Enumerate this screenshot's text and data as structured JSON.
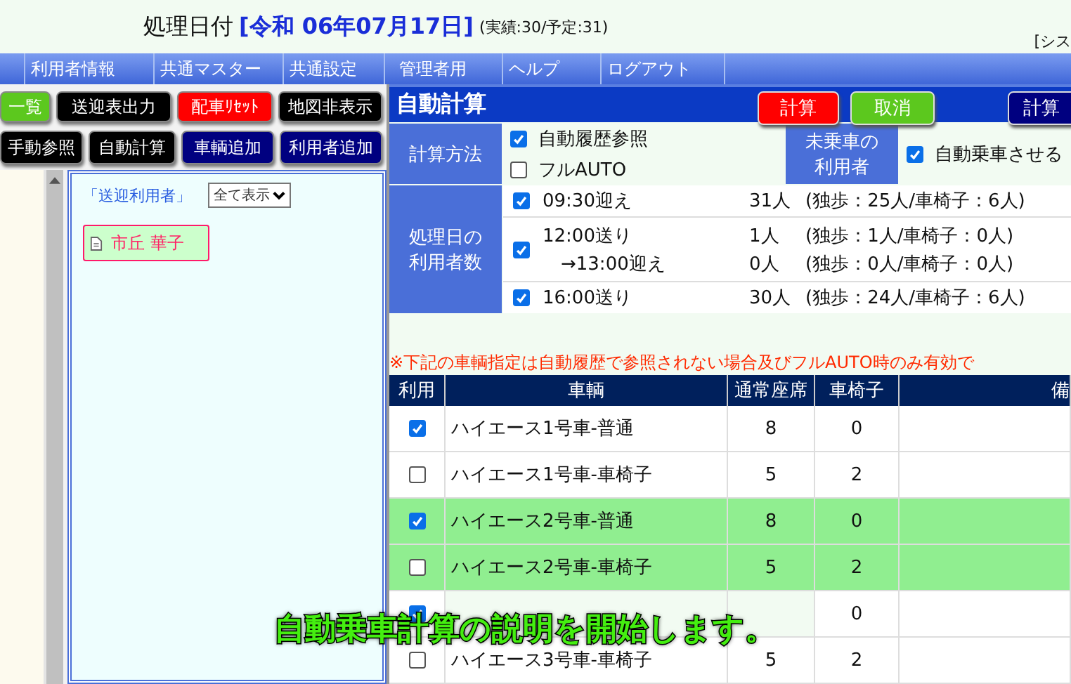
{
  "header": {
    "date_label": "処理日付",
    "date_value": "[令和 06年07月17日]",
    "counts": "(実績:30/予定:31)",
    "system_link": "[シス"
  },
  "menu": [
    "利用者情報",
    "共通マスター",
    "共通設定",
    "管理者用",
    "ヘルプ",
    "ログアウト"
  ],
  "left_buttons": [
    {
      "label": "一覧",
      "color": "#5cc81e"
    },
    {
      "label": "送迎表出力",
      "color": "#000000"
    },
    {
      "label": "配車ﾘｾｯﾄ",
      "color": "#ff0000"
    },
    {
      "label": "地図非表示",
      "color": "#000000"
    },
    {
      "label": "手動参照",
      "color": "#000000"
    },
    {
      "label": "自動計算",
      "color": "#000000"
    },
    {
      "label": "車輌追加",
      "color": "#000080"
    },
    {
      "label": "利用者追加",
      "color": "#000080"
    }
  ],
  "pickup_panel": {
    "title": "「送迎利用者」",
    "filter": "全て表示",
    "users": [
      "市丘 華子"
    ]
  },
  "auto_calc": {
    "title": "自動計算",
    "buttons": [
      {
        "label": "計算",
        "color": "#ff0000"
      },
      {
        "label": "取消",
        "color": "#5cc81e"
      },
      {
        "label": "計算",
        "color": "#000080"
      }
    ],
    "method_label": "計算方法",
    "methods": [
      {
        "label": "自動履歴参照",
        "checked": true
      },
      {
        "label": "フルAUTO",
        "checked": false
      }
    ],
    "unboarded_label": "未乗車の利用者",
    "unboarded_option": {
      "label": "自動乗車させる",
      "checked": true
    },
    "counts_label": "処理日の利用者数",
    "slots": [
      {
        "checked": true,
        "lines": [
          {
            "time": "09:30迎え",
            "count": "31人",
            "detail": "(独歩：25人/車椅子：6人)"
          }
        ]
      },
      {
        "checked": true,
        "lines": [
          {
            "time": "12:00送り",
            "count": "1人",
            "detail": "(独歩：1人/車椅子：0人)"
          },
          {
            "time": "→13:00迎え",
            "count": "0人",
            "detail": "(独歩：0人/車椅子：0人)"
          }
        ]
      },
      {
        "checked": true,
        "lines": [
          {
            "time": "16:00送り",
            "count": "30人",
            "detail": "(独歩：24人/車椅子：6人)"
          }
        ]
      }
    ],
    "notice": "※下記の車輌指定は自動履歴で参照されない場合及びフルAUTO時のみ有効で"
  },
  "vehicles": {
    "columns": [
      "利用",
      "車輌",
      "通常座席",
      "車椅子",
      "備"
    ],
    "rows": [
      {
        "checked": true,
        "highlighted": false,
        "name": "ハイエース1号車-普通",
        "seats": "8",
        "wheelchairs": "0"
      },
      {
        "checked": false,
        "highlighted": false,
        "name": "ハイエース1号車-車椅子",
        "seats": "5",
        "wheelchairs": "2"
      },
      {
        "checked": true,
        "highlighted": true,
        "name": "ハイエース2号車-普通",
        "seats": "8",
        "wheelchairs": "0"
      },
      {
        "checked": false,
        "highlighted": true,
        "name": "ハイエース2号車-車椅子",
        "seats": "5",
        "wheelchairs": "2"
      },
      {
        "checked": true,
        "highlighted": false,
        "wheelchairs": "0"
      },
      {
        "checked": false,
        "highlighted": false,
        "name": "ハイエース3号車-車椅子",
        "seats": "5",
        "wheelchairs": "2"
      }
    ]
  },
  "subtitle": "自動乗車計算の説明を開始します。"
}
